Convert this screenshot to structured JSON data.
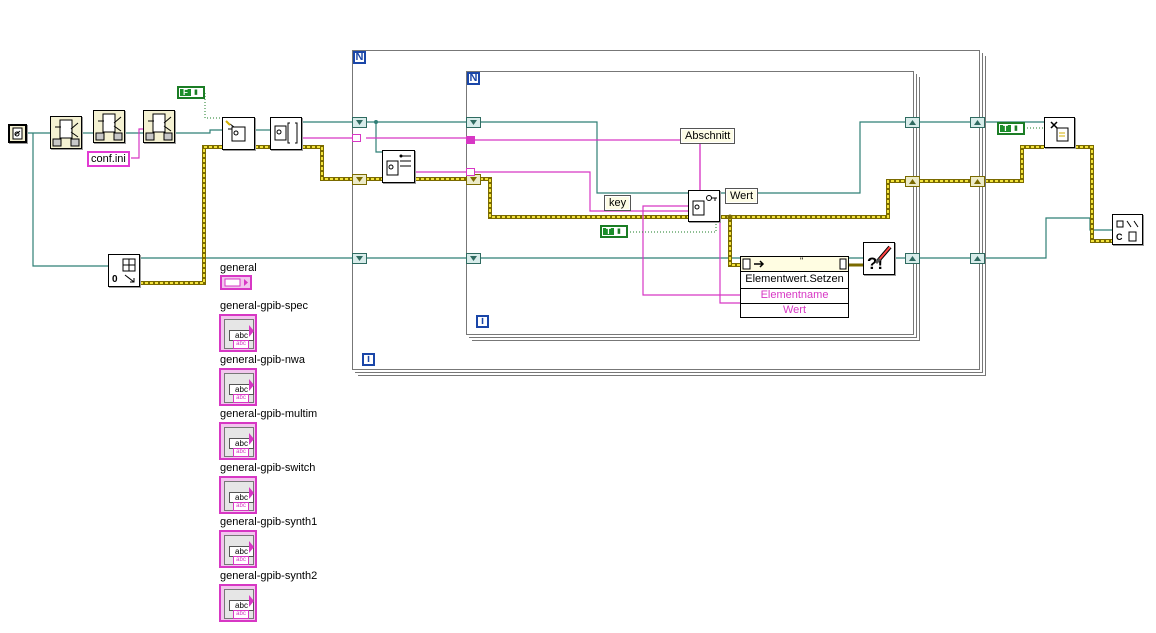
{
  "diagram": {
    "constants": {
      "config_file": "conf.ini",
      "section_label": "Abschnitt",
      "key_label": "key",
      "value_label": "Wert",
      "bool_false": "F",
      "bool_true": "T"
    },
    "loops": {
      "count_glyph": "N",
      "iteration_glyph": "i"
    },
    "property_node": {
      "header_glyph": "\"",
      "method": "Elementwert.Setzen",
      "params": [
        "Elementname",
        "Wert"
      ]
    },
    "controls": {
      "cluster_label": "general",
      "string_controls": [
        "general-gpib-spec",
        "general-gpib-nwa",
        "general-gpib-multim",
        "general-gpib-switch",
        "general-gpib-synth1",
        "general-gpib-synth2"
      ],
      "string_glyph": "abc",
      "substring_glyph": "abc"
    }
  }
}
